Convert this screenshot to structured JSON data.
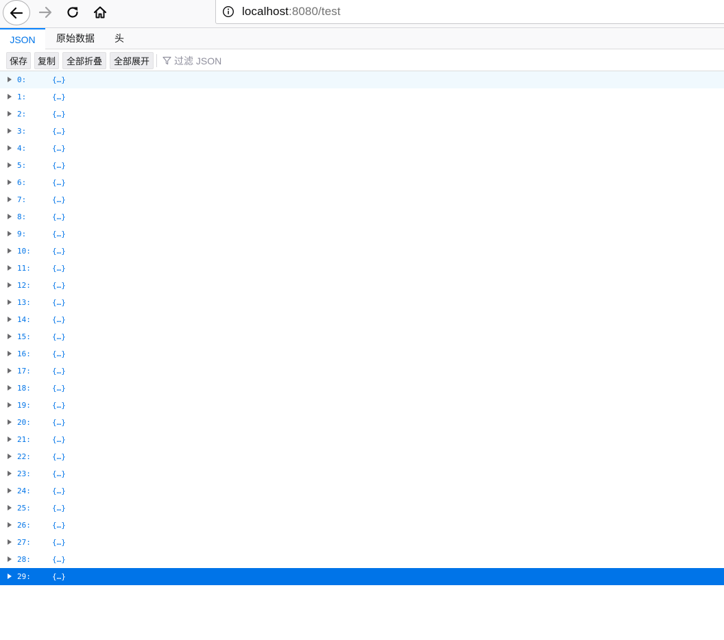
{
  "browser": {
    "url_host": "localhost",
    "url_path": ":8080/test",
    "icons": {
      "back": "back-arrow-icon",
      "forward": "forward-arrow-icon",
      "reload": "reload-icon",
      "home": "home-icon",
      "info": "info-icon"
    }
  },
  "viewer": {
    "tabs": [
      {
        "label": "JSON",
        "active": true
      },
      {
        "label": "原始数据",
        "active": false
      },
      {
        "label": "头",
        "active": false
      }
    ],
    "toolbar": {
      "save_label": "保存",
      "copy_label": "复制",
      "collapse_all_label": "全部折叠",
      "expand_all_label": "全部展开",
      "filter_placeholder": "过滤 JSON"
    }
  },
  "tree": {
    "hover_index": 0,
    "selected_index": 29,
    "rows": [
      {
        "key": "0:",
        "value": "{…}"
      },
      {
        "key": "1:",
        "value": "{…}"
      },
      {
        "key": "2:",
        "value": "{…}"
      },
      {
        "key": "3:",
        "value": "{…}"
      },
      {
        "key": "4:",
        "value": "{…}"
      },
      {
        "key": "5:",
        "value": "{…}"
      },
      {
        "key": "6:",
        "value": "{…}"
      },
      {
        "key": "7:",
        "value": "{…}"
      },
      {
        "key": "8:",
        "value": "{…}"
      },
      {
        "key": "9:",
        "value": "{…}"
      },
      {
        "key": "10:",
        "value": "{…}"
      },
      {
        "key": "11:",
        "value": "{…}"
      },
      {
        "key": "12:",
        "value": "{…}"
      },
      {
        "key": "13:",
        "value": "{…}"
      },
      {
        "key": "14:",
        "value": "{…}"
      },
      {
        "key": "15:",
        "value": "{…}"
      },
      {
        "key": "16:",
        "value": "{…}"
      },
      {
        "key": "17:",
        "value": "{…}"
      },
      {
        "key": "18:",
        "value": "{…}"
      },
      {
        "key": "19:",
        "value": "{…}"
      },
      {
        "key": "20:",
        "value": "{…}"
      },
      {
        "key": "21:",
        "value": "{…}"
      },
      {
        "key": "22:",
        "value": "{…}"
      },
      {
        "key": "23:",
        "value": "{…}"
      },
      {
        "key": "24:",
        "value": "{…}"
      },
      {
        "key": "25:",
        "value": "{…}"
      },
      {
        "key": "26:",
        "value": "{…}"
      },
      {
        "key": "27:",
        "value": "{…}"
      },
      {
        "key": "28:",
        "value": "{…}"
      },
      {
        "key": "29:",
        "value": "{…}"
      }
    ]
  },
  "colors": {
    "accent": "#0074e8",
    "row_hover": "#f0f9fe",
    "key_text": "#0074e8"
  }
}
